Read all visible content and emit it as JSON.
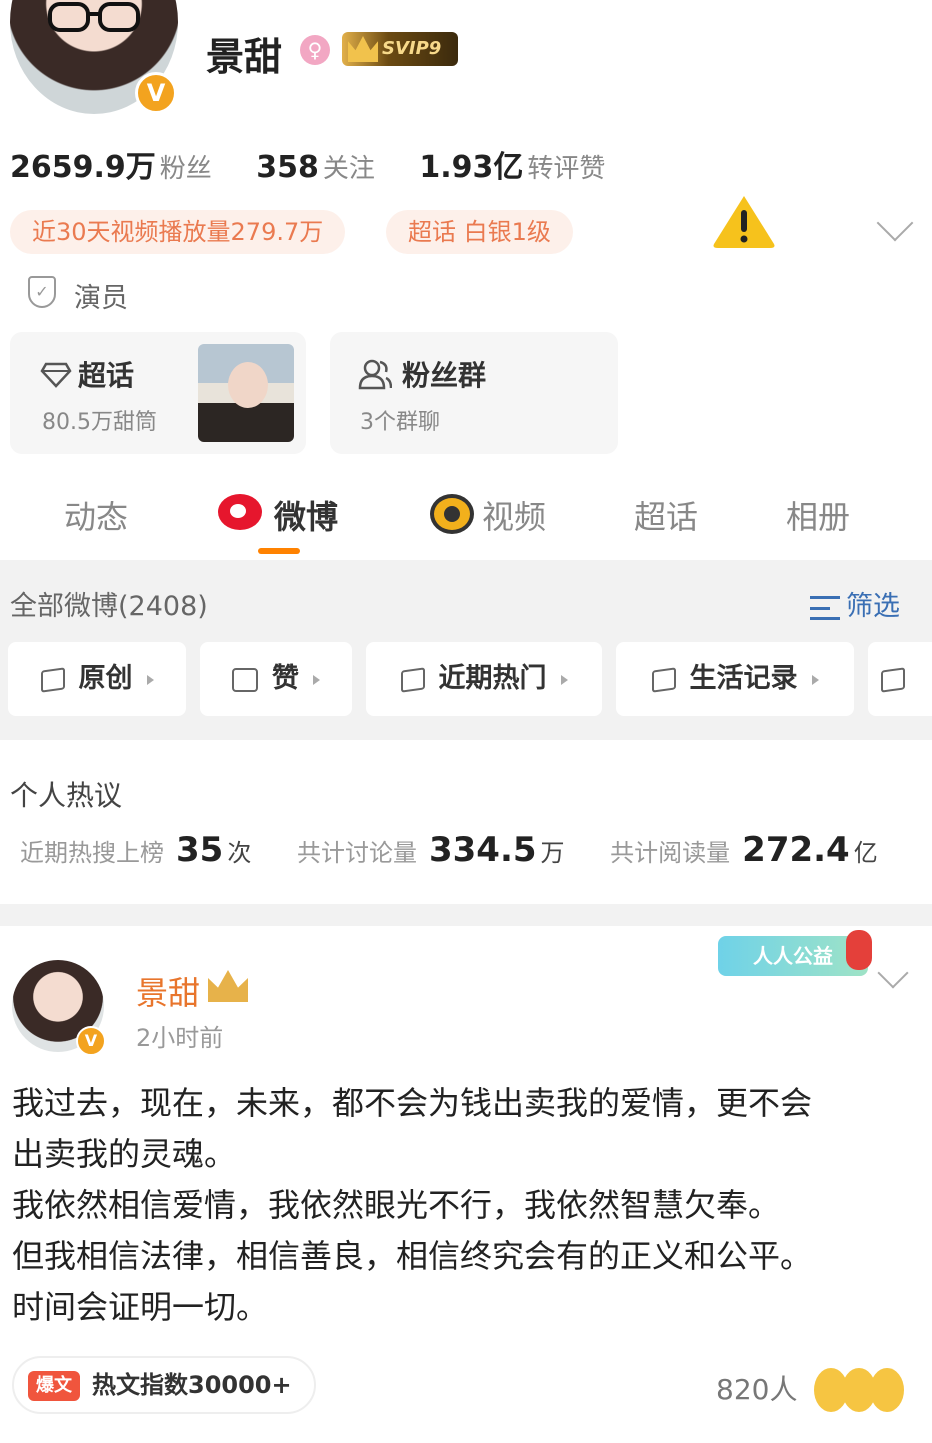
{
  "profile": {
    "name": "景甜",
    "gender_icon": "female-icon",
    "vip_badge": "SVIP9",
    "verified_badge": "V"
  },
  "stats": [
    {
      "value": "2659.9万",
      "label": "粉丝"
    },
    {
      "value": "358",
      "label": "关注"
    },
    {
      "value": "1.93亿",
      "label": "转评赞"
    }
  ],
  "chips": {
    "video_plays": "近30天视频播放量279.7万",
    "super_topic_level": "超话 白银1级"
  },
  "role": "演员",
  "cards": {
    "super_topic": {
      "title": "超话",
      "sub": "80.5万甜筒"
    },
    "fan_group": {
      "title": "粉丝群",
      "sub": "3个群聊"
    }
  },
  "tabs": [
    "动态",
    "微博",
    "视频",
    "超话",
    "相册"
  ],
  "active_tab": "微博",
  "feed": {
    "title": "全部微博(2408)",
    "filter_label": "筛选",
    "pills": [
      "原创",
      "赞",
      "近期热门",
      "生活记录"
    ]
  },
  "hot": {
    "title": "个人热议",
    "items": [
      {
        "label": "近期热搜上榜",
        "value": "35",
        "unit": "次"
      },
      {
        "label": "共计讨论量",
        "value": "334.5",
        "unit": "万"
      },
      {
        "label": "共计阅读量",
        "value": "272.4",
        "unit": "亿"
      }
    ]
  },
  "post": {
    "author": "景甜",
    "time": "2小时前",
    "verified_badge": "V",
    "charity_badge": "人人公益",
    "lines": [
      "我过去，现在，未来，都不会为钱出卖我的爱情，更不会",
      "出卖我的灵魂。",
      "我依然相信爱情，我依然眼光不行，我依然智慧欠奉。",
      "但我相信法律，相信善良，相信终究会有的正义和公平。",
      "时间会证明一切。"
    ],
    "hot_tag": "爆文",
    "hot_index": "热文指数30000+",
    "reactions": "820人"
  },
  "colors": {
    "accent_orange": "#ff8200",
    "author_orange": "#e8752c",
    "chip_text": "#ea7a50",
    "link_blue": "#3a6fb4",
    "warning_yellow": "#f6c21c"
  }
}
